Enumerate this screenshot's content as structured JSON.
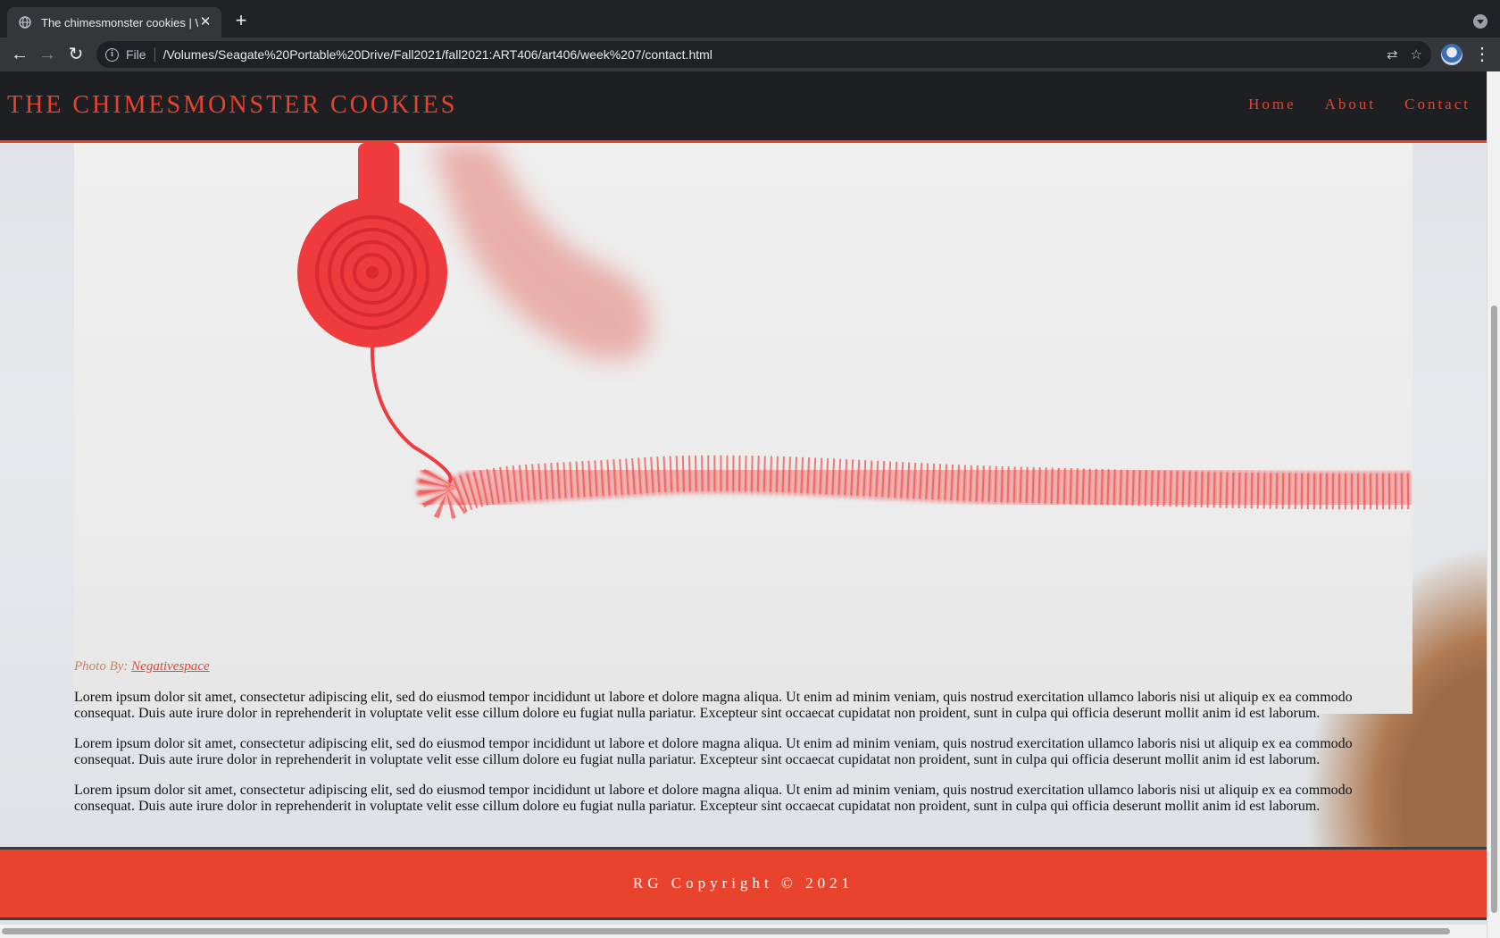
{
  "browser": {
    "tab_title": "The chimesmonster cookies | W",
    "new_tab_symbol": "+",
    "close_symbol": "✕",
    "back_symbol": "←",
    "forward_symbol": "→",
    "reload_symbol": "↻",
    "file_label": "File",
    "url": "/Volumes/Seagate%20Portable%20Drive/Fall2021/fall2021:ART406/art406/week%207/contact.html",
    "translate_symbol": "⇄",
    "bookmark_symbol": "☆",
    "menu_symbol": "⋮"
  },
  "site": {
    "title": "THE CHIMESMONSTER COOKIES",
    "nav": [
      "Home",
      "About",
      "Contact"
    ],
    "photo_credit_label": "Photo By:",
    "photo_credit_link": "Negativespace",
    "paragraphs": [
      "Lorem ipsum dolor sit amet, consectetur adipiscing elit, sed do eiusmod tempor incididunt ut labore et dolore magna aliqua. Ut enim ad minim veniam, quis nostrud exercitation ullamco laboris nisi ut aliquip ex ea commodo consequat. Duis aute irure dolor in reprehenderit in voluptate velit esse cillum dolore eu fugiat nulla pariatur. Excepteur sint occaecat cupidatat non proident, sunt in culpa qui officia deserunt mollit anim id est laborum.",
      "Lorem ipsum dolor sit amet, consectetur adipiscing elit, sed do eiusmod tempor incididunt ut labore et dolore magna aliqua. Ut enim ad minim veniam, quis nostrud exercitation ullamco laboris nisi ut aliquip ex ea commodo consequat. Duis aute irure dolor in reprehenderit in voluptate velit esse cillum dolore eu fugiat nulla pariatur. Excepteur sint occaecat cupidatat non proident, sunt in culpa qui officia deserunt mollit anim id est laborum.",
      "Lorem ipsum dolor sit amet, consectetur adipiscing elit, sed do eiusmod tempor incididunt ut labore et dolore magna aliqua. Ut enim ad minim veniam, quis nostrud exercitation ullamco laboris nisi ut aliquip ex ea commodo consequat. Duis aute irure dolor in reprehenderit in voluptate velit esse cillum dolore eu fugiat nulla pariatur. Excepteur sint occaecat cupidatat non proident, sunt in culpa qui officia deserunt mollit anim id est laborum."
    ],
    "footer": "RG Copyright © 2021"
  },
  "colors": {
    "accent": "#e8432d",
    "header_bg": "#1e1f22",
    "chrome_bg": "#202124"
  }
}
